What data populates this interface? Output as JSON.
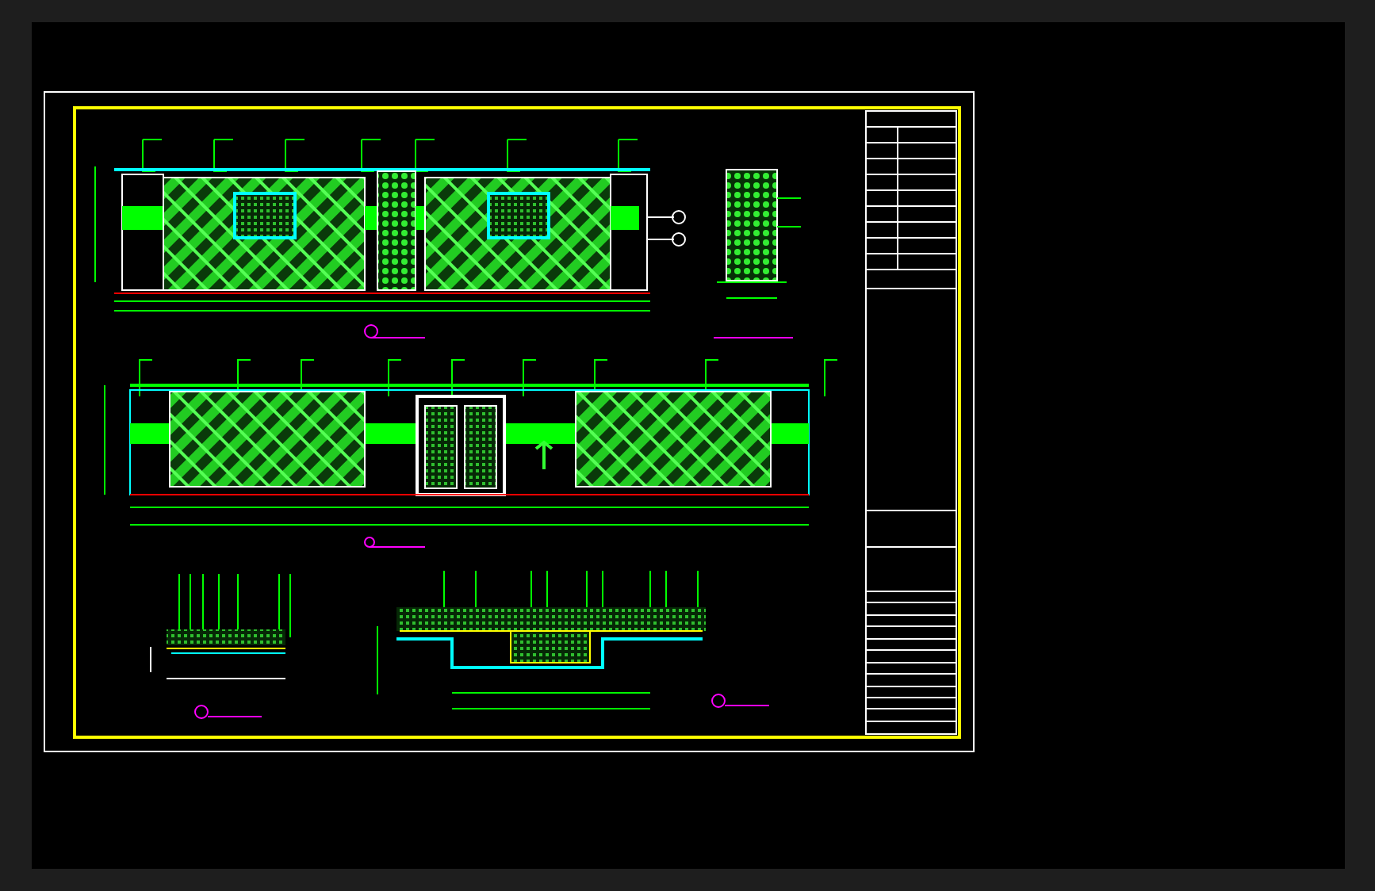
{
  "drawing_sheet": {
    "views": [
      {
        "kind": "wall-elevation-with-column"
      },
      {
        "kind": "panel-side-view"
      },
      {
        "kind": "wall-elevation-with-door"
      },
      {
        "kind": "small-section"
      },
      {
        "kind": "large-section"
      },
      {
        "kind": "title-block"
      }
    ]
  }
}
